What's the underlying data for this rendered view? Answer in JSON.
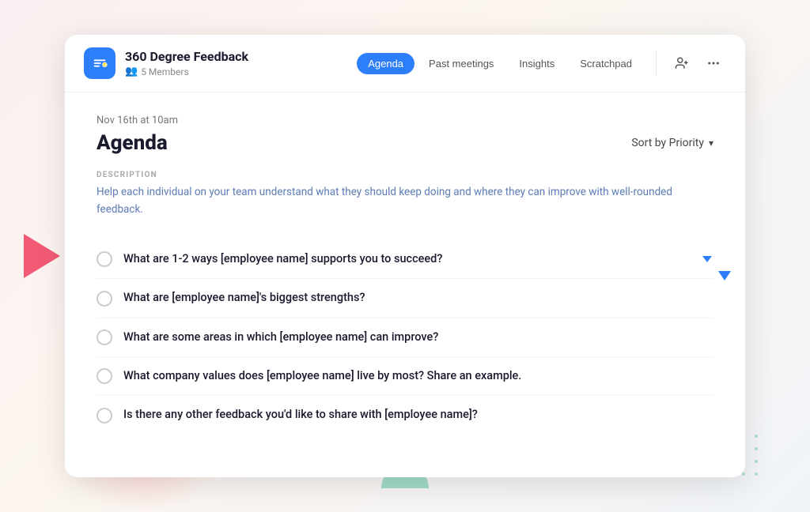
{
  "background": {
    "triangle_color": "#f04060",
    "dots_color": "#8ecfb8"
  },
  "header": {
    "app_icon_color": "#2d7ff9",
    "meeting_title": "360 Degree Feedback",
    "members_count": "5 Members",
    "nav_tabs": [
      {
        "label": "Agenda",
        "active": true
      },
      {
        "label": "Past meetings",
        "active": false
      },
      {
        "label": "Insights",
        "active": false
      },
      {
        "label": "Scratchpad",
        "active": false
      }
    ],
    "add_member_icon": "person-add",
    "more_icon": "ellipsis"
  },
  "content": {
    "date_label": "Nov 16th at 10am",
    "page_title": "Agenda",
    "sort_label": "Sort by Priority",
    "sort_chevron": "▾",
    "section_label": "DESCRIPTION",
    "description": "Help each individual on your team understand what they should keep doing and where they can improve with well-rounded feedback.",
    "agenda_items": [
      {
        "text": "What are 1-2 ways [employee name] supports you to succeed?",
        "has_dropdown": true
      },
      {
        "text": "What are [employee name]'s biggest strengths?",
        "has_dropdown": false
      },
      {
        "text": "What are some areas in which [employee name] can improve?",
        "has_dropdown": false
      },
      {
        "text": "What company values does [employee name] live by most? Share an example.",
        "has_dropdown": false
      },
      {
        "text": "Is there any other feedback you'd like to share with [employee name]?",
        "has_dropdown": false
      }
    ]
  }
}
